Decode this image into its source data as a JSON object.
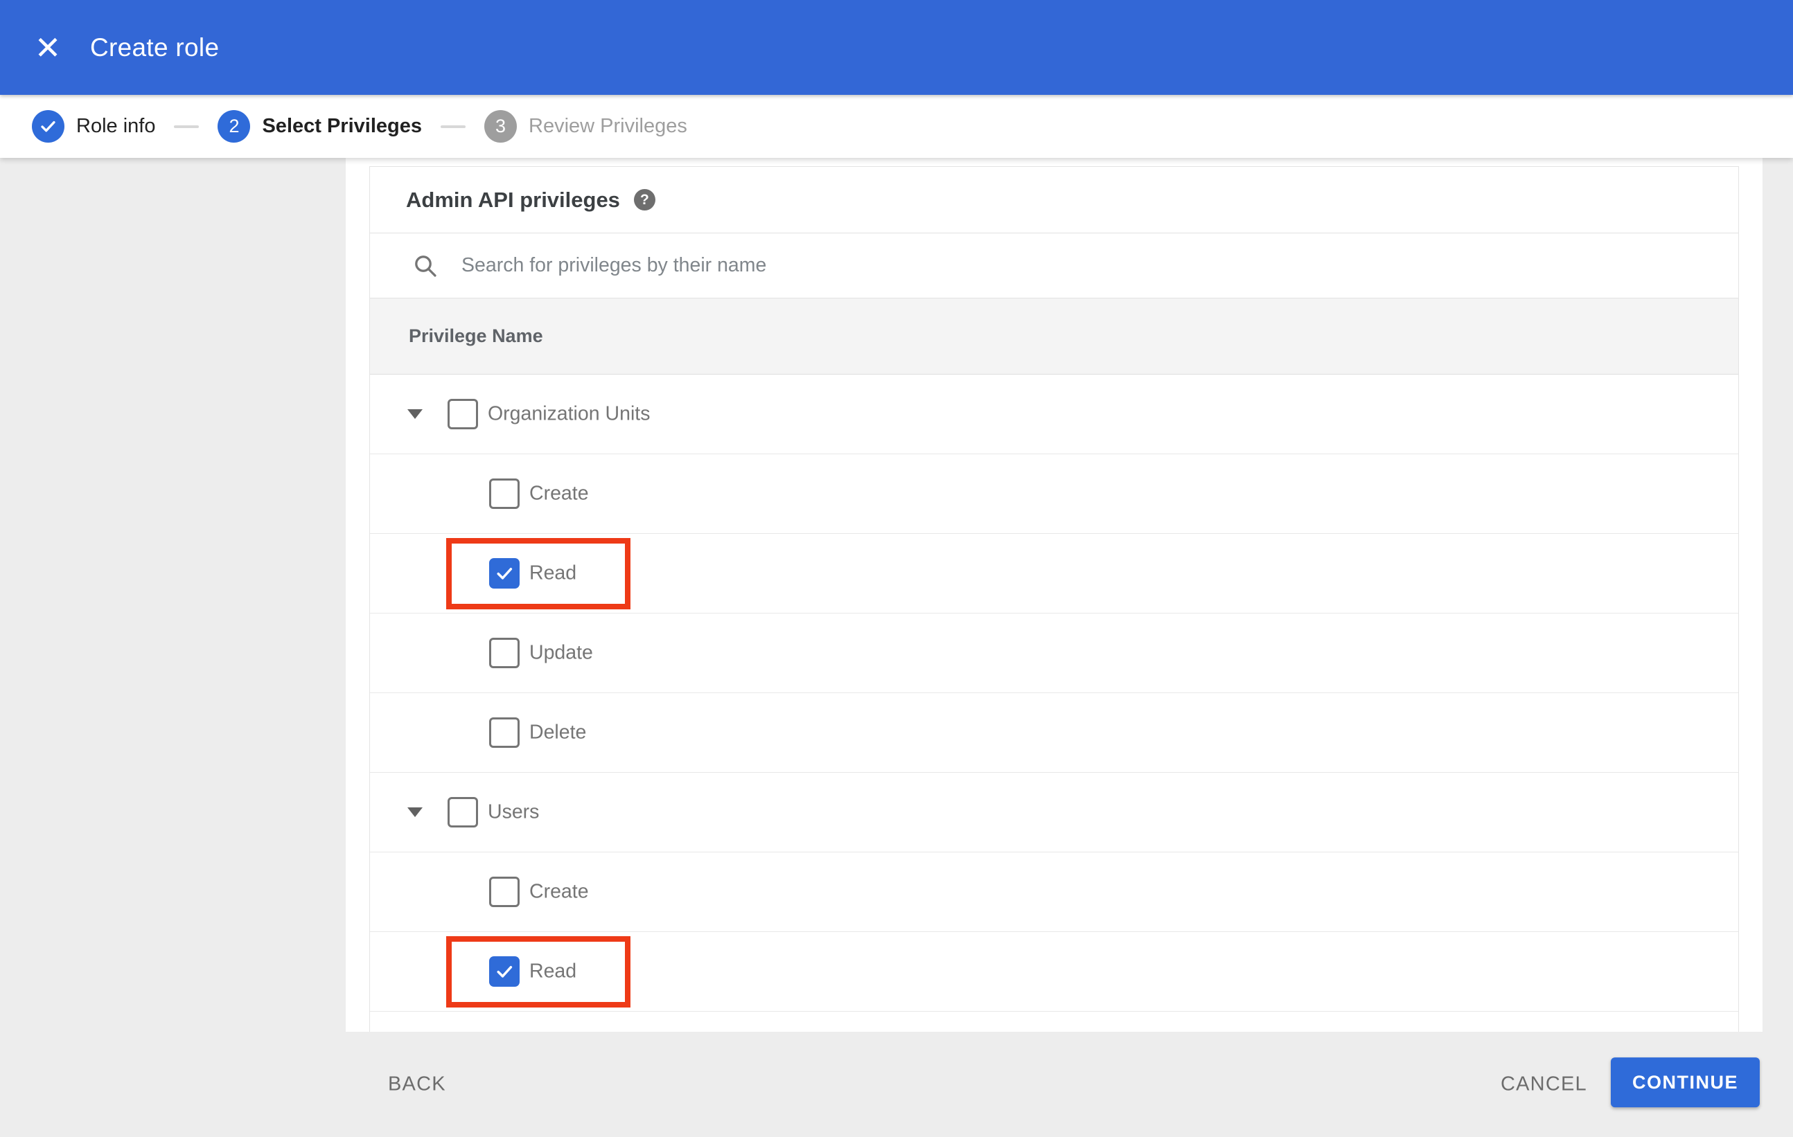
{
  "app_bar": {
    "title": "Create role",
    "close_glyph": "✕"
  },
  "stepper": {
    "steps": [
      {
        "number": "1",
        "label": "Role info",
        "state": "completed"
      },
      {
        "number": "2",
        "label": "Select Privileges",
        "state": "active"
      },
      {
        "number": "3",
        "label": "Review Privileges",
        "state": "upcoming"
      }
    ]
  },
  "panel": {
    "title": "Admin API privileges",
    "help_glyph": "?",
    "search": {
      "placeholder": "Search for privileges by their name",
      "value": ""
    },
    "table": {
      "column_header": "Privilege Name",
      "rows": [
        {
          "label": "Organization Units",
          "level": "group",
          "expanded": true,
          "checked": false,
          "highlighted": false
        },
        {
          "label": "Create",
          "level": "child",
          "checked": false,
          "highlighted": false
        },
        {
          "label": "Read",
          "level": "child",
          "checked": true,
          "highlighted": true
        },
        {
          "label": "Update",
          "level": "child",
          "checked": false,
          "highlighted": false
        },
        {
          "label": "Delete",
          "level": "child",
          "checked": false,
          "highlighted": false
        },
        {
          "label": "Users",
          "level": "group",
          "expanded": true,
          "checked": false,
          "highlighted": false
        },
        {
          "label": "Create",
          "level": "child",
          "checked": false,
          "highlighted": false
        },
        {
          "label": "Read",
          "level": "child",
          "checked": true,
          "highlighted": true
        }
      ]
    }
  },
  "footer": {
    "back_label": "BACK",
    "cancel_label": "CANCEL",
    "continue_label": "CONTINUE"
  },
  "colors": {
    "appbar_blue": "#3367d6",
    "step_active_blue": "#2f6bd9",
    "checkbox_blue": "#2f6bd8",
    "continue_blue": "#2f6bd9",
    "highlight_red": "#ee3a17",
    "step_inactive_gray": "#9e9e9e",
    "side_panel_gray": "#ededed",
    "table_header_gray": "#f4f4f4"
  }
}
